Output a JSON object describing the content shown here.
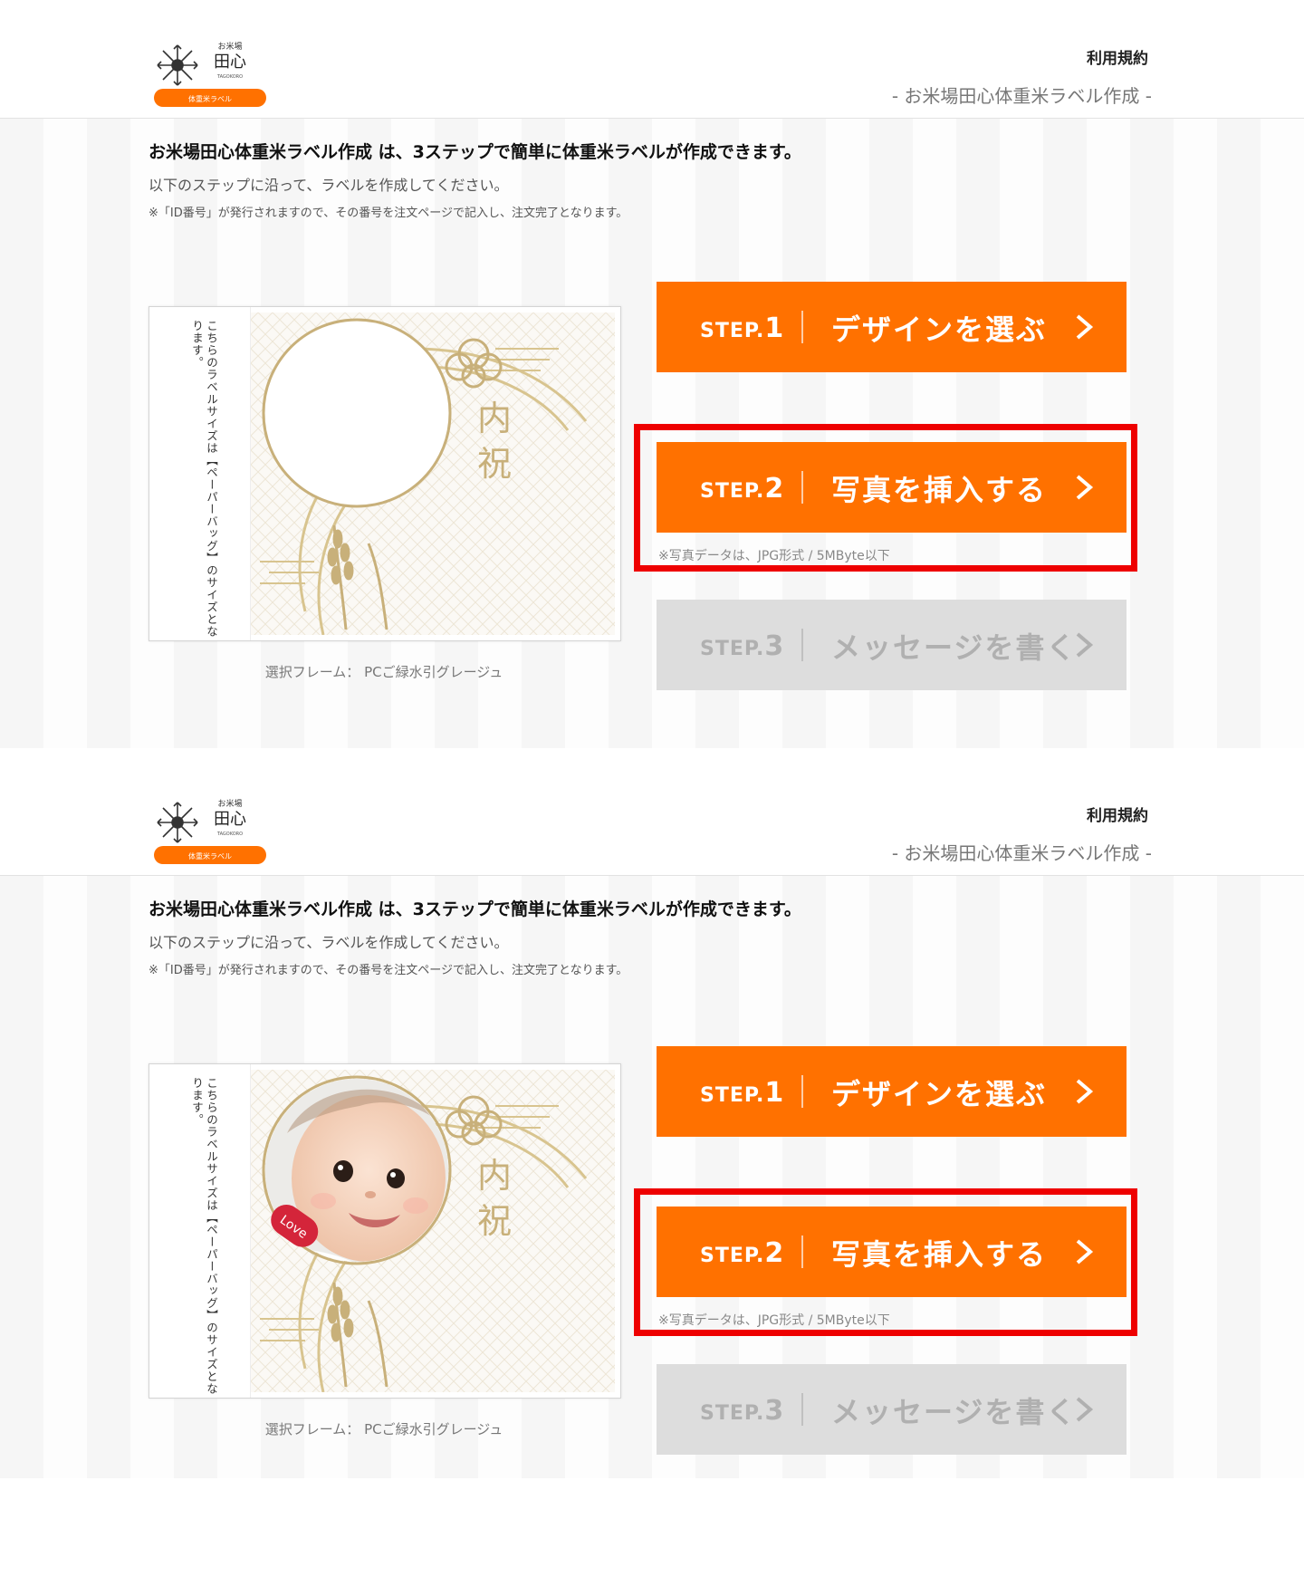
{
  "header": {
    "logo_small": "お米場",
    "logo_main": "田心",
    "logo_roman": "TAGOKORO",
    "logo_badge": "体重米ラベル",
    "terms_link": "利用規約",
    "subtitle": "- お米場田心体重米ラベル作成 -"
  },
  "intro": {
    "lead": "お米場田心体重米ラベル作成 は、3ステップで簡単に体重米ラベルが作成できます。",
    "instruction": "以下のステップに沿って、ラベルを作成してください。",
    "note": "※「ID番号」が発行されますので、その番号を注文ページで記入し、注文完了となります。"
  },
  "preview": {
    "vertical_text": "こちらのラベルサイズは【ペーパーバッグ】のサイズとなります。",
    "label_char_1": "内",
    "label_char_2": "祝",
    "sticker_text": "Love",
    "frame_caption": "選択フレーム： PCご緑水引グレージュ"
  },
  "steps": [
    {
      "label": "STEP.",
      "num": "1",
      "text": "デザインを選ぶ",
      "state": "active"
    },
    {
      "label": "STEP.",
      "num": "2",
      "text": "写真を挿入する",
      "state": "active"
    },
    {
      "label": "STEP.",
      "num": "3",
      "text": "メッセージを書く",
      "state": "disabled"
    }
  ],
  "photo_note": "※写真データは、JPG形式 / 5MByte以下",
  "colors": {
    "accent": "#ff7100",
    "disabled": "#dddddd",
    "highlight": "#ee0000",
    "gold": "#c8b07a"
  },
  "icons": {
    "step_arrow": "chevron-right-icon",
    "logo_mark": "snowflake-crest-icon"
  }
}
